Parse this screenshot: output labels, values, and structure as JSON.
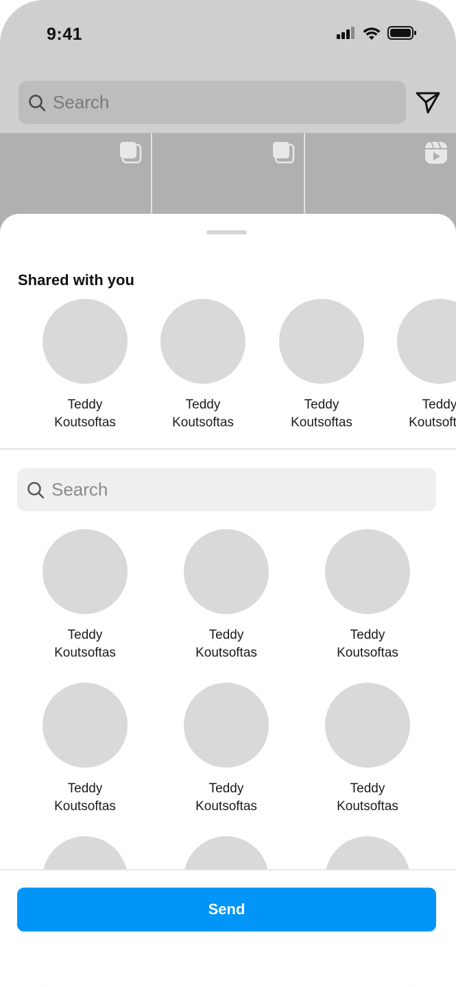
{
  "status_bar": {
    "time": "9:41"
  },
  "top_search": {
    "placeholder": "Search"
  },
  "sheet": {
    "section_title": "Shared with you",
    "shared_contacts": [
      {
        "line1": "Teddy",
        "line2": "Koutsoftas"
      },
      {
        "line1": "Teddy",
        "line2": "Koutsoftas"
      },
      {
        "line1": "Teddy",
        "line2": "Koutsoftas"
      },
      {
        "line1": "Teddy",
        "line2": "Koutsoftas"
      }
    ],
    "search": {
      "placeholder": "Search"
    },
    "contacts": [
      {
        "line1": "Teddy",
        "line2": "Koutsoftas"
      },
      {
        "line1": "Teddy",
        "line2": "Koutsoftas"
      },
      {
        "line1": "Teddy",
        "line2": "Koutsoftas"
      },
      {
        "line1": "Teddy",
        "line2": "Koutsoftas"
      },
      {
        "line1": "Teddy",
        "line2": "Koutsoftas"
      },
      {
        "line1": "Teddy",
        "line2": "Koutsoftas"
      },
      {
        "line1": "",
        "line2": ""
      },
      {
        "line1": "",
        "line2": ""
      },
      {
        "line1": "",
        "line2": ""
      }
    ],
    "send_label": "Send"
  },
  "colors": {
    "accent": "#0095f6",
    "avatar": "#d9d9d9"
  },
  "icons": [
    "search-icon",
    "send-icon",
    "carousel-icon",
    "reels-icon",
    "signal-icon",
    "wifi-icon",
    "battery-icon"
  ]
}
